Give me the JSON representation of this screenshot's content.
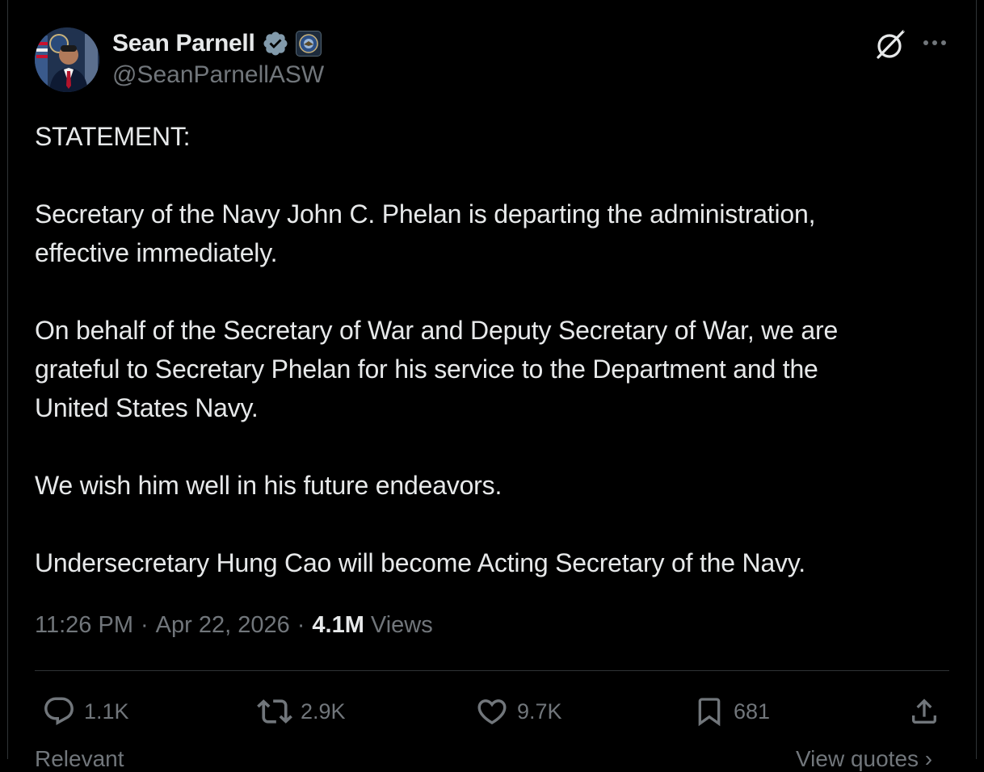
{
  "author": {
    "display_name": "Sean Parnell",
    "handle": "@SeanParnellASW",
    "verified": true
  },
  "post": {
    "paragraphs": [
      [
        "STATEMENT:"
      ],
      [
        "Secretary of the Navy John C. Phelan is departing the administration,",
        "effective immediately."
      ],
      [
        "On behalf of the Secretary of War and Deputy Secretary of War, we are",
        "grateful to Secretary Phelan for his service to the Department and the",
        "United States Navy."
      ],
      [
        "We wish him well in his future endeavors."
      ],
      [
        "Undersecretary Hung Cao will become Acting Secretary of the Navy."
      ]
    ],
    "time": "11:26 PM",
    "date": "Apr 22, 2026",
    "views_count": "4.1M",
    "views_label": "Views"
  },
  "actions": {
    "replies": "1.1K",
    "reposts": "2.9K",
    "likes": "9.7K",
    "bookmarks": "681"
  },
  "footer": {
    "left": "Relevant",
    "right": "View quotes ›"
  },
  "colors": {
    "background": "#000000",
    "text": "#e7e9ea",
    "secondary": "#71767b",
    "verified": "#829aab",
    "divider": "#2f3336"
  },
  "icons": {
    "verified": "verified-badge-icon",
    "affiliation": "department-seal-icon",
    "grok": "grok-icon",
    "more": "more-icon",
    "reply": "reply-icon",
    "repost": "repost-icon",
    "like": "heart-icon",
    "bookmark": "bookmark-icon",
    "share": "share-icon"
  }
}
